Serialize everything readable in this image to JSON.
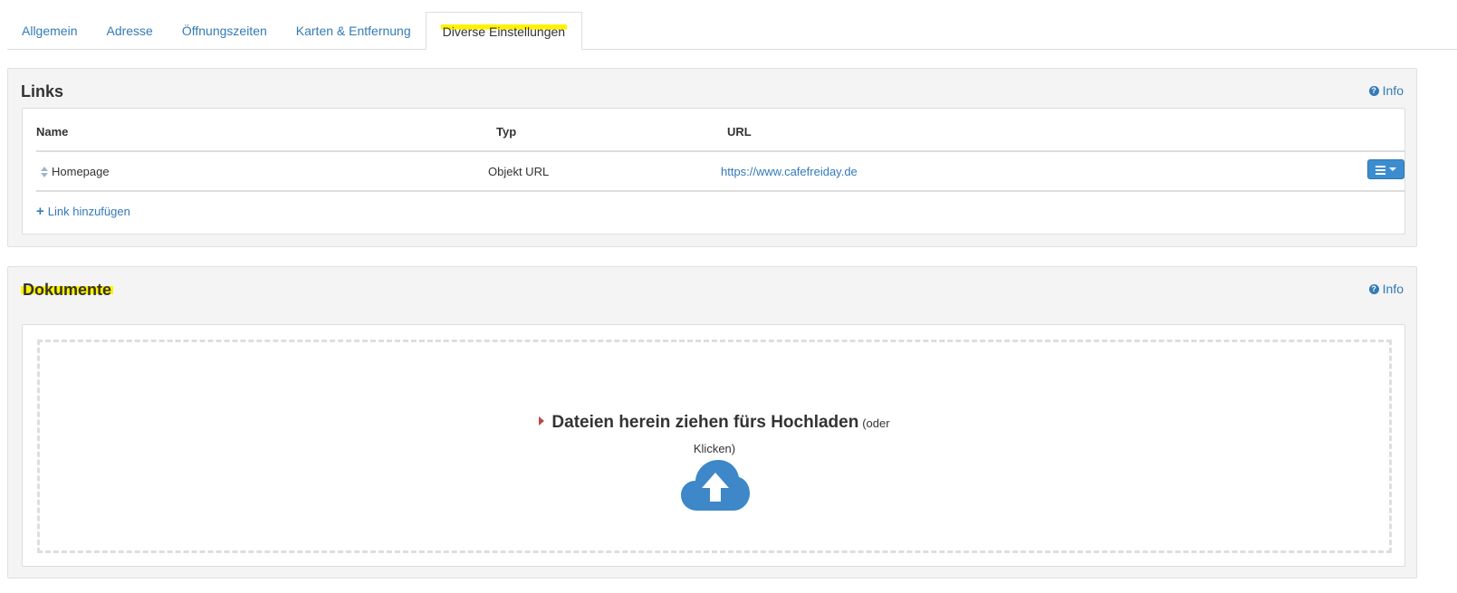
{
  "tabs": [
    {
      "label": "Allgemein",
      "active": false
    },
    {
      "label": "Adresse",
      "active": false
    },
    {
      "label": "Öffnungszeiten",
      "active": false
    },
    {
      "label": "Karten & Entfernung",
      "active": false
    },
    {
      "label": "Diverse Einstellungen",
      "active": true
    }
  ],
  "links": {
    "title": "Links",
    "info": "Info",
    "columns": {
      "name": "Name",
      "typ": "Typ",
      "url": "URL"
    },
    "rows": [
      {
        "name": "Homepage",
        "typ": "Objekt URL",
        "url": "https://www.cafefreiday.de"
      }
    ],
    "add_label": "Link hinzufügen"
  },
  "documents": {
    "title": "Dokumente",
    "info": "Info",
    "dropzone_main": "Dateien herein ziehen fürs Hochladen",
    "dropzone_or": "(oder",
    "dropzone_click": "Klicken)"
  },
  "colors": {
    "accent": "#337ab7",
    "button": "#3c8dd0",
    "highlight": "#fff200",
    "caret": "#b94a48"
  },
  "icons": {
    "info": "question-circle-icon",
    "sort": "sort-icon",
    "menu": "bars-icon",
    "add": "plus-icon",
    "upload": "cloud-upload-icon"
  }
}
